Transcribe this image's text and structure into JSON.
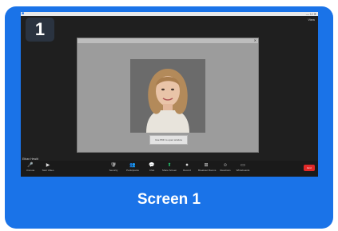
{
  "card": {
    "badge_number": "1",
    "caption": "Screen 1"
  },
  "window": {
    "view_label": "View",
    "title_controls": "— ☐ ✕"
  },
  "dialog": {
    "title": "",
    "button_label": "Use PDF to open window"
  },
  "participant": {
    "name": "Ethan Hewitt"
  },
  "toolbar": {
    "items": [
      {
        "icon": "microphone-icon",
        "glyph": "🎤",
        "label": "Unmute"
      },
      {
        "icon": "camera-icon",
        "glyph": "▶",
        "label": "Start Video"
      },
      {
        "icon": "security-icon",
        "glyph": "🛡",
        "label": "Security"
      },
      {
        "icon": "participants-icon",
        "glyph": "👥",
        "label": "Participants"
      },
      {
        "icon": "chat-icon",
        "glyph": "💬",
        "label": "Chat"
      },
      {
        "icon": "share-screen-icon",
        "glyph": "⬆",
        "label": "Share Screen"
      },
      {
        "icon": "record-icon",
        "glyph": "⏺",
        "label": "Record"
      },
      {
        "icon": "breakout-rooms-icon",
        "glyph": "⊞",
        "label": "Breakout Rooms"
      },
      {
        "icon": "reactions-icon",
        "glyph": "☺",
        "label": "Reactions"
      },
      {
        "icon": "whiteboards-icon",
        "glyph": "▭",
        "label": "Whiteboards"
      }
    ],
    "end_label": "End"
  },
  "colors": {
    "card_blue": "#1a73e8",
    "end_red": "#e02828",
    "share_green": "#23c26b"
  }
}
